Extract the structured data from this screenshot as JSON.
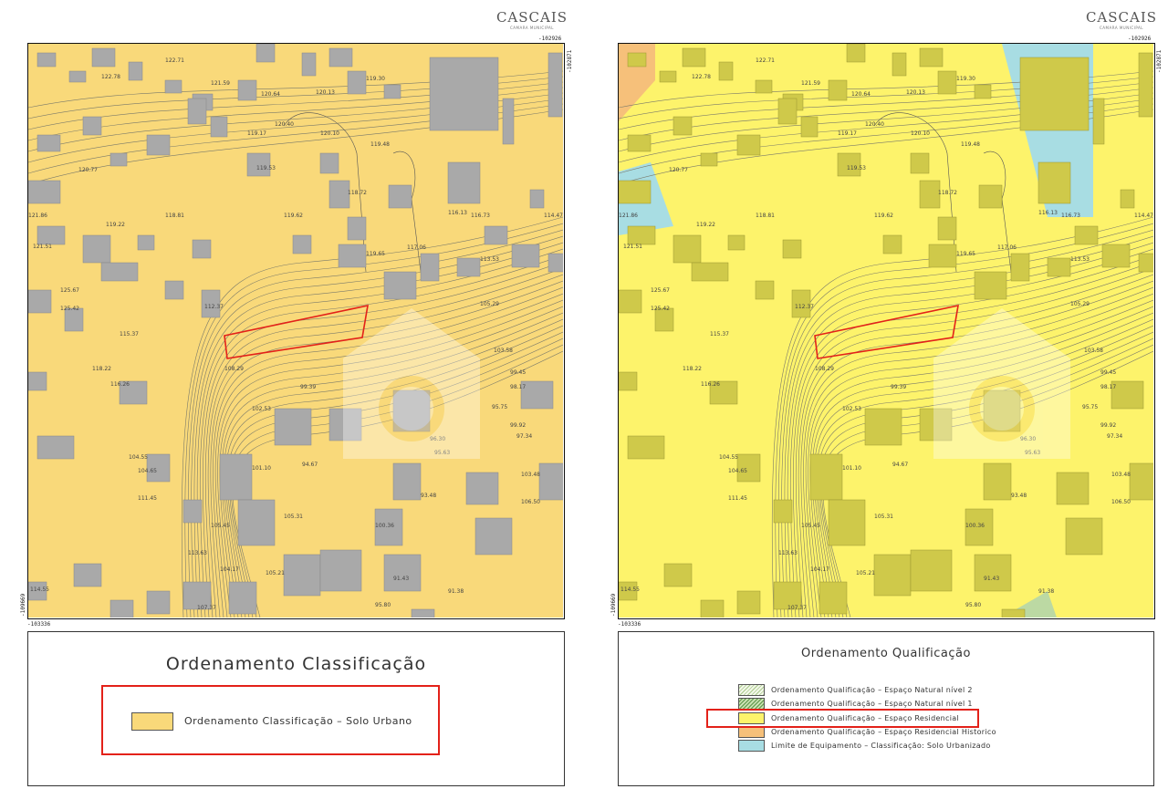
{
  "header": {
    "logo_text": "CASCAIS",
    "logo_subtext": "CAMARA MUNICIPAL"
  },
  "coordinates": {
    "top_right": "-102926",
    "right_vertical": "-102871",
    "bottom_left": "-103336",
    "left_vertical": "-109669"
  },
  "elevations": [
    "122.71",
    "122.78",
    "121.59",
    "120.64",
    "120.13",
    "119.30",
    "120.40",
    "120.10",
    "119.48",
    "119.17",
    "119.53",
    "120.77",
    "119.22",
    "118.81",
    "119.62",
    "118.72",
    "116.13",
    "116.73",
    "114.47",
    "121.86",
    "121.51",
    "117.06",
    "113.53",
    "119.65",
    "125.67",
    "112.37",
    "105.29",
    "125.42",
    "115.37",
    "103.58",
    "108.29",
    "118.22",
    "99.45",
    "116.26",
    "99.39",
    "98.17",
    "95.75",
    "99.92",
    "102.53",
    "97.34",
    "104.55",
    "96.30",
    "95.63",
    "101.10",
    "94.67",
    "103.48",
    "111.45",
    "106.50",
    "104.65",
    "93.48",
    "105.45",
    "113.63",
    "105.31",
    "100.36",
    "105.21",
    "104.17",
    "91.43",
    "114.55",
    "107.37",
    "91.38",
    "95.80"
  ],
  "left_panel": {
    "legend_title": "Ordenamento Classificação",
    "legend_items": [
      {
        "label": "Ordenamento Classificação – Solo Urbano",
        "color": "#f9d97a"
      }
    ]
  },
  "right_panel": {
    "legend_title": "Ordenamento Qualificação",
    "legend_items": [
      {
        "label": "Ordenamento Qualificação – Espaço Natural nível 2",
        "color": "#e3efd2"
      },
      {
        "label": "Ordenamento Qualificação – Espaço Natural nível 1",
        "color": "#bcd9a3"
      },
      {
        "label": "Ordenamento Qualificação – Espaço Residencial",
        "color": "#fdf36b"
      },
      {
        "label": "Ordenamento Qualificação – Espaço Residencial Historico",
        "color": "#f6c07a"
      },
      {
        "label": "Limite de Equipamento – Classificação: Solo Urbanizado",
        "color": "#a8dde3"
      }
    ]
  },
  "colors": {
    "highlight": "#e32119",
    "building_left": "#a9a9a9",
    "building_right": "#cfc94a"
  }
}
